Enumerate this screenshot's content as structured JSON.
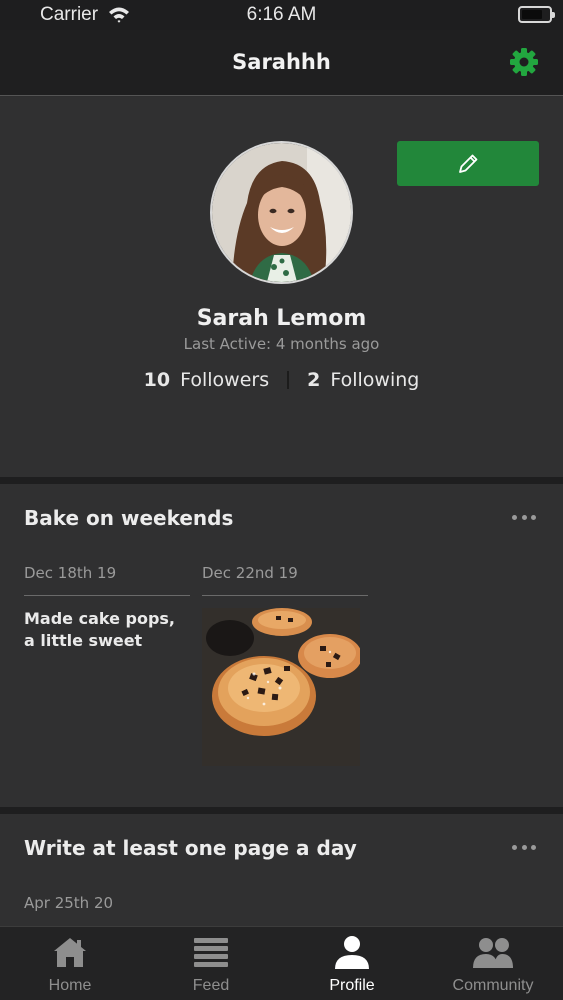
{
  "status_bar": {
    "carrier": "Carrier",
    "time": "6:16 AM"
  },
  "nav": {
    "title": "Sarahhh",
    "settings_icon": "gear-icon"
  },
  "profile": {
    "name": "Sarah Lemom",
    "last_active": "Last Active: 4 months ago",
    "followers_count": "10",
    "followers_label": "Followers",
    "following_count": "2",
    "following_label": "Following",
    "edit_icon": "pencil-icon"
  },
  "habits": [
    {
      "title": "Bake on weekends",
      "entries": [
        {
          "date": "Dec 18th 19",
          "text": "Made cake pops, a little sweet"
        },
        {
          "date": "Dec 22nd 19",
          "photo": "cookie-photo"
        }
      ]
    },
    {
      "title": "Write at least one page a day",
      "entries": [
        {
          "date": "Apr 25th 20"
        }
      ]
    }
  ],
  "tabs": [
    {
      "label": "Home",
      "icon": "home-icon"
    },
    {
      "label": "Feed",
      "icon": "feed-icon"
    },
    {
      "label": "Profile",
      "icon": "profile-icon",
      "active": true
    },
    {
      "label": "Community",
      "icon": "community-icon"
    }
  ],
  "colors": {
    "accent": "#22873a",
    "background": "#303031",
    "bar": "#1f1f20"
  }
}
